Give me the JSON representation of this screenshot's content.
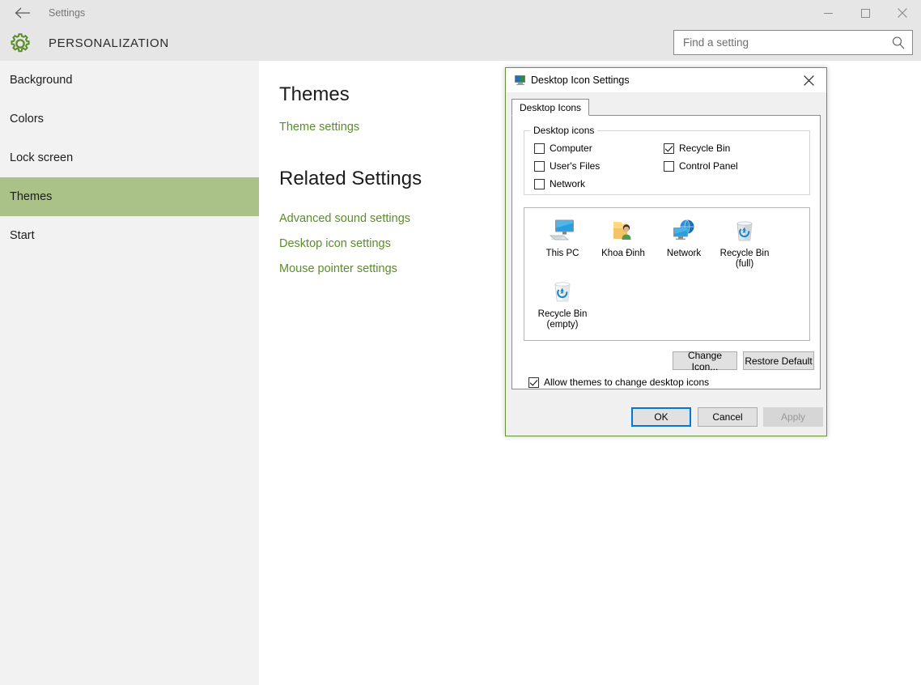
{
  "window": {
    "titlebar_title": "Settings",
    "back_icon": "back-arrow-icon",
    "minimize_label": "Minimize",
    "maximize_label": "Maximize",
    "close_label": "Close"
  },
  "header": {
    "title": "PERSONALIZATION",
    "icon": "gear-icon",
    "accent_color": "#6a9339"
  },
  "search": {
    "placeholder": "Find a setting",
    "value": "",
    "icon": "search-icon"
  },
  "sidebar": {
    "items": [
      {
        "label": "Background",
        "selected": false
      },
      {
        "label": "Colors",
        "selected": false
      },
      {
        "label": "Lock screen",
        "selected": false
      },
      {
        "label": "Themes",
        "selected": true
      },
      {
        "label": "Start",
        "selected": false
      }
    ],
    "selected_color": "#aac287"
  },
  "main": {
    "title": "Themes",
    "theme_settings_link": "Theme settings",
    "related_title": "Related Settings",
    "related_links": [
      "Advanced sound settings",
      "Desktop icon settings",
      "Mouse pointer settings"
    ],
    "link_color": "#5b8c2a"
  },
  "dialog": {
    "title": "Desktop Icon Settings",
    "icon": "monitor-icon",
    "close_icon": "close-icon",
    "tab": "Desktop Icons",
    "group_label": "Desktop icons",
    "checkboxes": [
      {
        "label": "Computer",
        "checked": false
      },
      {
        "label": "User's Files",
        "checked": false
      },
      {
        "label": "Network",
        "checked": false
      },
      {
        "label": "Recycle Bin",
        "checked": true
      },
      {
        "label": "Control Panel",
        "checked": false
      }
    ],
    "preview_icons": [
      {
        "label": "This PC",
        "icon": "this-pc-icon"
      },
      {
        "label": "Khoa Đinh",
        "icon": "user-folder-icon"
      },
      {
        "label": "Network",
        "icon": "network-globe-icon"
      },
      {
        "label": "Recycle Bin\n(full)",
        "icon": "recycle-bin-full-icon"
      },
      {
        "label": "Recycle Bin\n(empty)",
        "icon": "recycle-bin-empty-icon"
      }
    ],
    "change_icon_button": "Change Icon...",
    "restore_default_button": "Restore Default",
    "allow_themes_checkbox": {
      "label": "Allow themes to change desktop icons",
      "checked": true
    },
    "footer_buttons": [
      {
        "label": "OK",
        "state": "default-focused"
      },
      {
        "label": "Cancel",
        "state": "normal"
      },
      {
        "label": "Apply",
        "state": "disabled"
      }
    ]
  }
}
